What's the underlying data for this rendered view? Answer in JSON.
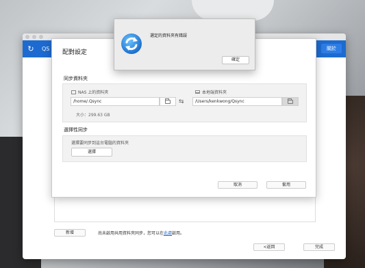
{
  "app": {
    "brand_title": "QS",
    "close_label": "關於"
  },
  "main": {
    "add_label": "新增",
    "footer_note_before": "尚未啟用共用資料夾同步，您可以在",
    "footer_note_link": "此處",
    "footer_note_after": "啟用。",
    "back_label": "<返回",
    "done_label": "完成"
  },
  "pair_dialog": {
    "title": "配對設定",
    "sync_folder": {
      "section_title": "同步資料夾",
      "nas_label": "NAS 上的資料夾",
      "local_label": "本地端資料夾",
      "nas_path": "/home/.Qsync",
      "local_path": "/Users/kenkwong/Qsync",
      "size_text": "大小：299.63 GB"
    },
    "selective": {
      "section_title": "選擇性同步",
      "description": "選擇要同步到這台電腦的資料夾",
      "choose_label": "選擇"
    },
    "cancel_label": "取消",
    "apply_label": "套用"
  },
  "alert": {
    "message": "選定的資料夾有錯誤",
    "ok_label": "確定"
  },
  "colors": {
    "accent": "#1d6bd1",
    "alert_icon": "#1e8fe6"
  },
  "icons": [
    "qsync-logo-icon",
    "nas-folder-icon",
    "computer-icon",
    "folder-icon",
    "swap-arrows-icon",
    "sync-refresh-icon"
  ]
}
